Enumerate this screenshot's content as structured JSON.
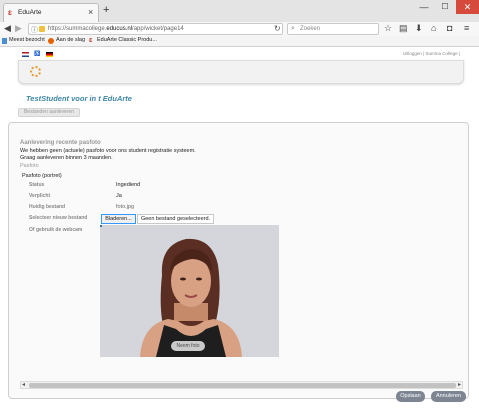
{
  "browser": {
    "tab_title": "EduArte",
    "tab_close": "×",
    "new_tab": "+",
    "url_prefix": "https://summacollege.",
    "url_domain": "educus.nl",
    "url_path": "/app/wicket/page14",
    "search_placeholder": "Zoeken",
    "window_controls": {
      "min": "—",
      "max": "☐",
      "close": "✕"
    }
  },
  "bookmarks": [
    {
      "label": "Meest bezocht"
    },
    {
      "label": "Aan de slag"
    },
    {
      "label": "EduArte Classic Produ..."
    }
  ],
  "page": {
    "top_links": "Uitloggen | Summa College |",
    "title": "TestStudent voor in t EduArte",
    "aanleveren_button": "Bestanden aanleveren",
    "section_title": "Aanlevering recente pasfoto",
    "desc_line1": "We hebben geen (actuele) pasfoto voor ons student registratie systeem.",
    "desc_line2": "Graag aanleveren binnen 3 maanden.",
    "pasfoto_label": "Pasfoto",
    "pasfoto_portret": "Pasfoto (portret)",
    "rows": [
      {
        "label": "Status",
        "value": "Ingediend"
      },
      {
        "label": "Verplicht",
        "value": "Ja"
      },
      {
        "label": "Huidig bestand",
        "value": "foto.jpg"
      },
      {
        "label": "Selecteer nieuw bestand",
        "value": ""
      },
      {
        "label": "Of gebruik de webcam",
        "value": ""
      }
    ],
    "browse_button": "Bladeren...",
    "no_file_selected": "Geen bestand geselecteerd.",
    "webcam_capture_label": "Neem foto",
    "save_button": "Opslaan",
    "cancel_button": "Annuleren"
  },
  "colors": {
    "title_blue": "#3f86a6",
    "footer_button": "#7d8593",
    "close_red": "#d64a3b"
  }
}
